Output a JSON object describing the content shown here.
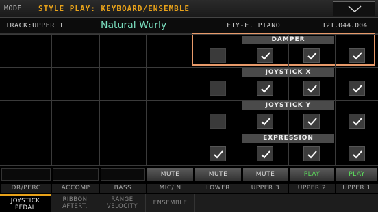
{
  "header": {
    "mode_label": "MODE",
    "mode_value": "STYLE PLAY: KEYBOARD/ENSEMBLE"
  },
  "track": {
    "label": "TRACK:UPPER 1",
    "sound": "Natural Wurly",
    "bank": "FTY-E. PIANO",
    "number": "121.044.004"
  },
  "sections": [
    {
      "name": "DAMPER",
      "lower": false,
      "upper3": true,
      "upper2": true,
      "upper1": true
    },
    {
      "name": "JOYSTICK X",
      "lower": false,
      "upper3": true,
      "upper2": true,
      "upper1": true
    },
    {
      "name": "JOYSTICK Y",
      "lower": false,
      "upper3": true,
      "upper2": true,
      "upper1": true
    },
    {
      "name": "EXPRESSION",
      "lower": true,
      "upper3": true,
      "upper2": true,
      "upper1": true
    }
  ],
  "mute_buttons": [
    "",
    "",
    "",
    "MUTE",
    "MUTE",
    "MUTE",
    "PLAY",
    "PLAY"
  ],
  "channels": [
    "DR/PERC",
    "ACCOMP",
    "BASS",
    "MIC/IN",
    "LOWER",
    "UPPER 3",
    "UPPER 2",
    "UPPER 1"
  ],
  "tabs": [
    {
      "line1": "JOYSTICK",
      "line2": "PEDAL"
    },
    {
      "line1": "RIBBON",
      "line2": "AFTERT."
    },
    {
      "line1": "RANGE",
      "line2": "VELOCITY"
    },
    {
      "line1": "ENSEMBLE",
      "line2": ""
    }
  ],
  "colors": {
    "accent": "#e8a21a",
    "sound": "#7be0c0",
    "play": "#5be05b",
    "highlight": "#e89a6a"
  },
  "icons": {
    "menu": "chevron-down-icon",
    "check": "check-icon"
  }
}
